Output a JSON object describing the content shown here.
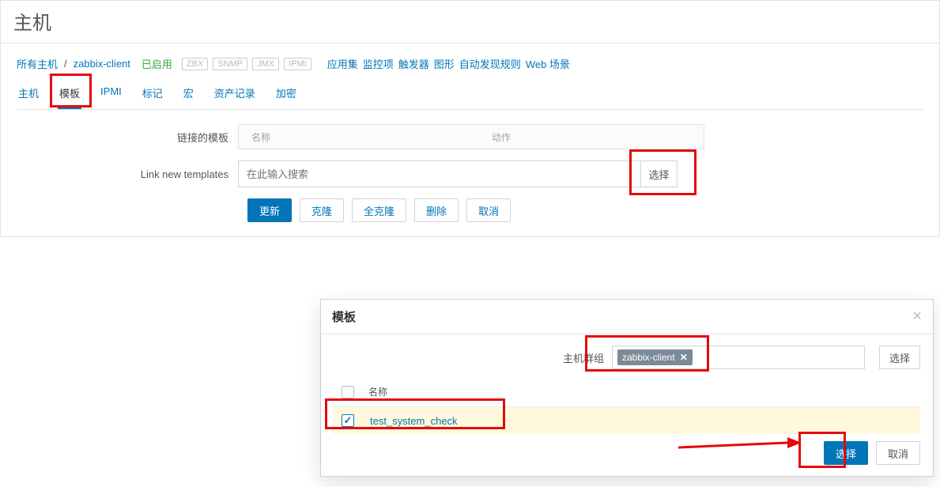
{
  "page": {
    "title": "主机"
  },
  "breadcrumb": {
    "all_hosts": "所有主机",
    "host": "zabbix-client",
    "enabled": "已启用",
    "pills": [
      "ZBX",
      "SNMP",
      "JMX",
      "IPMI"
    ],
    "links": [
      "应用集",
      "监控项",
      "触发器",
      "图形",
      "自动发现规则",
      "Web 场景"
    ]
  },
  "tabs": [
    "主机",
    "模板",
    "IPMI",
    "标记",
    "宏",
    "资产记录",
    "加密"
  ],
  "active_tab_index": 1,
  "form": {
    "linked_label": "链接的模板",
    "linked_cols": {
      "name": "名称",
      "action": "动作"
    },
    "linknew_label": "Link new templates",
    "search_placeholder": "在此输入搜索",
    "select": "选择"
  },
  "actions": {
    "update": "更新",
    "clone": "克隆",
    "full_clone": "全克隆",
    "delete": "删除",
    "cancel": "取消"
  },
  "modal": {
    "title": "模板",
    "group_label": "主机群组",
    "chip": "zabbix-client",
    "select": "选择",
    "col_name": "名称",
    "row_item": "test_system_check",
    "ok": "选择",
    "cancel": "取消"
  }
}
